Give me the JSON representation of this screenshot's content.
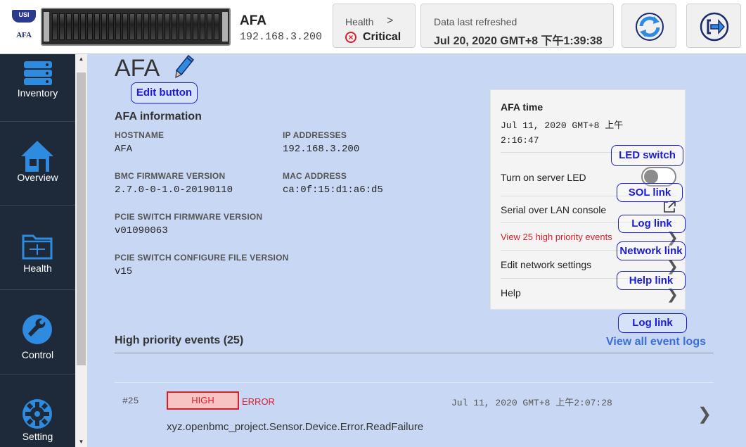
{
  "header": {
    "logo_text": "USI",
    "logo_sub": "AFA",
    "system_name": "AFA",
    "system_ip": "192.168.3.200",
    "health_label": "Health",
    "health_chevron": ">",
    "health_status": "Critical",
    "refresh_label": "Data last refreshed",
    "refresh_value": "Jul 20, 2020 GMT+8 下午1:39:38"
  },
  "sidebar": {
    "items": [
      {
        "label": "Inventory",
        "icon": "server-stack-icon"
      },
      {
        "label": "Overview",
        "icon": "house-icon"
      },
      {
        "label": "Health",
        "icon": "folder-icon"
      },
      {
        "label": "Control",
        "icon": "wrench-icon"
      },
      {
        "label": "Setting",
        "icon": "gear-icon"
      }
    ]
  },
  "main": {
    "title": "AFA",
    "edit_tag": "Edit button",
    "info_title": "AFA information",
    "fields": {
      "hostname_label": "HOSTNAME",
      "hostname_value": "AFA",
      "ip_label": "IP ADDRESSES",
      "ip_value": "192.168.3.200",
      "bmc_label": "BMC FIRMWARE VERSION",
      "bmc_value": "2.7.0-0-1.0-20190110",
      "mac_label": "MAC ADDRESS",
      "mac_value": "ca:0f:15:d1:a6:d5",
      "pcie_fw_label": "PCIE SWITCH FIRMWARE VERSION",
      "pcie_fw_value": "v01090063",
      "pcie_cfg_label": "PCIE SWITCH CONFIGURE FILE VERSION",
      "pcie_cfg_value": "v15"
    },
    "panel": {
      "time_label": "AFA time",
      "time_value": "Jul 11, 2020 GMT+8 上午 2:16:47",
      "led_label": "Turn on server LED",
      "led_on": false,
      "sol_label": "Serial over LAN console",
      "events_link": "View 25 high priority events",
      "network_label": "Edit network settings",
      "help_label": "Help",
      "chevron": "❯"
    },
    "tags": {
      "led": "LED switch",
      "sol": "SOL link",
      "log": "Log link",
      "network": "Network link",
      "help": "Help link",
      "log2": "Log link"
    },
    "events_title": "High priority events (25)",
    "view_all": "View all event logs",
    "events": [
      {
        "id": "#25",
        "severity": "HIGH",
        "type": "ERROR",
        "time": "Jul 11, 2020 GMT+8 上午2:07:28",
        "message": "xyz.openbmc_project.Sensor.Device.Error.ReadFailure",
        "chevron": "❯"
      }
    ]
  },
  "colors": {
    "sidebar_bg": "#1e2a39",
    "main_bg": "#c8d8f4",
    "accent_blue": "#2e6fe0",
    "critical_red": "#d8202c",
    "tag_blue": "#1b1bd8"
  }
}
